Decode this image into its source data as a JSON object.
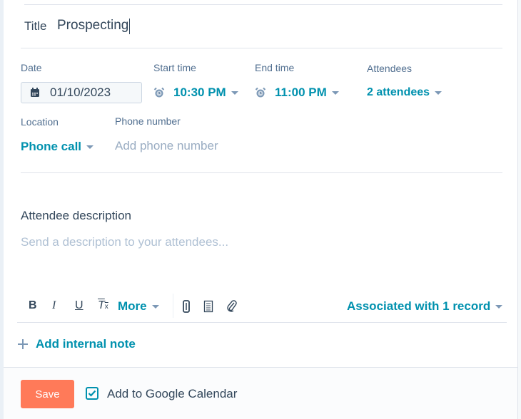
{
  "title": {
    "label": "Title",
    "value": "Prospecting"
  },
  "date": {
    "label": "Date",
    "value": "01/10/2023"
  },
  "start_time": {
    "label": "Start time",
    "value": "10:30 PM"
  },
  "end_time": {
    "label": "End time",
    "value": "11:00 PM"
  },
  "attendees": {
    "label": "Attendees",
    "value": "2 attendees"
  },
  "location": {
    "label": "Location",
    "value": "Phone call"
  },
  "phone": {
    "label": "Phone number",
    "placeholder": "Add phone number"
  },
  "description": {
    "label": "Attendee description",
    "placeholder": "Send a description to your attendees..."
  },
  "toolbar": {
    "bold": "B",
    "italic": "I",
    "underline": "U",
    "clear_format": "T",
    "more_label": "More",
    "icons": [
      "snippet-icon",
      "document-icon",
      "attachment-icon"
    ]
  },
  "associations": {
    "label": "Associated with 1 record"
  },
  "internal_note": {
    "label": "Add internal note"
  },
  "footer": {
    "save_label": "Save",
    "gcal_label": "Add to Google Calendar",
    "gcal_checked": true
  },
  "colors": {
    "accent": "#0091ae",
    "save": "#ff7a59",
    "text": "#33475b",
    "muted": "#516f90",
    "placeholder": "#99acc2"
  }
}
